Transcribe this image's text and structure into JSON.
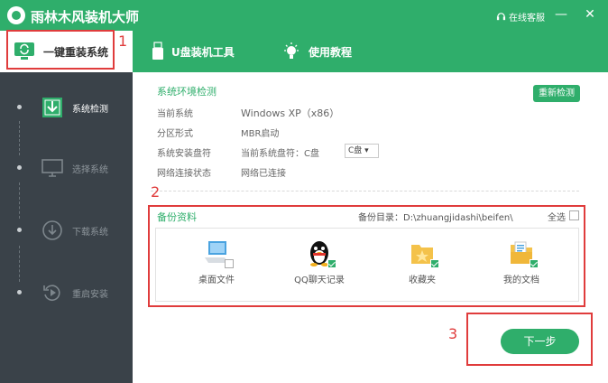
{
  "app": {
    "title": "雨林木风装机大师",
    "service_label": "在线客服"
  },
  "window_controls": {
    "minimize": "—",
    "close": "✕"
  },
  "nav": {
    "tabs": [
      {
        "label": "一键重装系统",
        "icon": "reinstall-icon"
      },
      {
        "label": "U盘装机工具",
        "icon": "usb-drive-icon"
      },
      {
        "label": "使用教程",
        "icon": "lightbulb-icon"
      }
    ]
  },
  "sidebar": {
    "steps": [
      {
        "label": "系统检测",
        "icon": "scan-icon",
        "active": true
      },
      {
        "label": "选择系统",
        "icon": "monitor-icon",
        "active": false
      },
      {
        "label": "下载系统",
        "icon": "download-icon",
        "active": false
      },
      {
        "label": "重启安装",
        "icon": "restart-icon",
        "active": false
      }
    ]
  },
  "env": {
    "title": "系统环境检测",
    "redetect_label": "重新检测",
    "rows": [
      {
        "label": "当前系统",
        "value": "Windows XP（x86）"
      },
      {
        "label": "分区形式",
        "value": "MBR启动"
      },
      {
        "label": "系统安装盘符",
        "value": "当前系统盘符：C盘"
      },
      {
        "label": "网络连接状态",
        "value": "网络已连接"
      }
    ],
    "drive_select": "C盘 ▾"
  },
  "backup": {
    "title": "备份资料",
    "dir_label": "备份目录：D:\\zhuangjidashi\\beifen\\",
    "select_all": "全选",
    "items": [
      {
        "label": "桌面文件",
        "icon": "desktop-computer-icon",
        "checked": false
      },
      {
        "label": "QQ聊天记录",
        "icon": "qq-penguin-icon",
        "checked": true
      },
      {
        "label": "收藏夹",
        "icon": "favorites-folder-icon",
        "checked": true
      },
      {
        "label": "我的文档",
        "icon": "documents-folder-icon",
        "checked": true
      }
    ]
  },
  "next_label": "下一步",
  "annotations": [
    "1",
    "2",
    "3"
  ],
  "colors": {
    "brand_green": "#2fae6b",
    "sidebar": "#3a4249",
    "annotation_red": "#e03c3c"
  }
}
